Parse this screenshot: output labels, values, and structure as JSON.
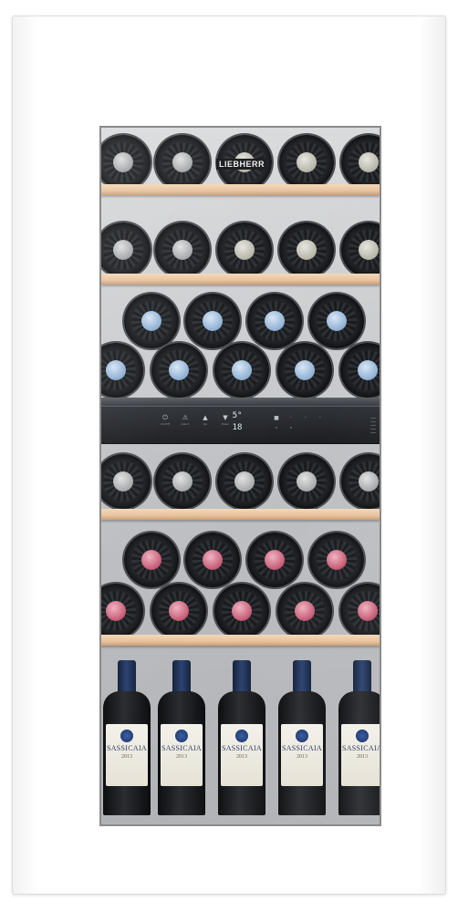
{
  "appliance": {
    "brand": "LIEBHERR",
    "colors": {
      "frame": "#ffffff",
      "glass": "#26292d",
      "shelf_wood": "#e8c29c",
      "capsule_blue": "#8fb0d3",
      "capsule_red": "#c45a73"
    }
  },
  "control_panel": {
    "left_buttons": [
      {
        "icon": "power-icon",
        "glyph": "⏻",
        "label": "On/Off"
      },
      {
        "icon": "alarm-icon",
        "glyph": "⚠",
        "label": "Alarm"
      },
      {
        "icon": "up-arrow-icon",
        "glyph": "▲",
        "label": "Up"
      },
      {
        "icon": "down-arrow-icon",
        "glyph": "▼",
        "label": "Down"
      }
    ],
    "display_upper": "5°",
    "display_lower": "18",
    "right_keys": [
      {
        "icon": "zone-icon",
        "glyph": "■"
      },
      {
        "icon": "light-icon",
        "glyph": "·"
      },
      {
        "icon": "set-icon",
        "glyph": "·"
      },
      {
        "icon": "menu-icon",
        "glyph": "·"
      }
    ],
    "right_arrows": [
      {
        "icon": "up-small-icon",
        "glyph": "˄"
      },
      {
        "icon": "down-small-icon",
        "glyph": "˅"
      }
    ]
  },
  "standing_bottles": [
    {
      "label": "SASSICAIA",
      "year": "2013"
    },
    {
      "label": "SASSICAIA",
      "year": "2013"
    },
    {
      "label": "SASSICAIA",
      "year": "2013"
    },
    {
      "label": "SASSICAIA",
      "year": "2013"
    },
    {
      "label": "SASSICAIA",
      "year": "2013"
    }
  ]
}
